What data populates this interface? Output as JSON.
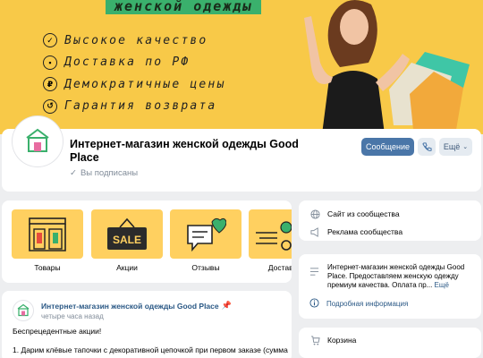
{
  "cover": {
    "title": "женской одежды",
    "features": [
      {
        "text": "Высокое качество",
        "icon": "quality-badge-icon"
      },
      {
        "text": "Доставка по РФ",
        "icon": "delivery-truck-icon"
      },
      {
        "text": "Демократичные цены",
        "icon": "ruble-icon"
      },
      {
        "text": "Гарантия возврата",
        "icon": "return-arrow-icon"
      }
    ]
  },
  "profile": {
    "name": "Интернет-магазин женской одежды Good Place",
    "status": "Вы подписаны",
    "message_label": "Сообщение",
    "more_label": "Ещё"
  },
  "categories": [
    {
      "label": "Товары",
      "icon": "storefront-icon"
    },
    {
      "label": "Акции",
      "icon": "sale-sign-icon"
    },
    {
      "label": "Отзывы",
      "icon": "heart-chat-icon"
    },
    {
      "label": "Доставка",
      "icon": "delivery-icon"
    }
  ],
  "post": {
    "author": "Интернет-магазин женской одежды Good Place",
    "time": "четыре часа назад",
    "text1": "Беспрецедентные акции!",
    "text2": "1. Дарим клёвые тапочки с декоративной цепочкой при первом заказе (сумма"
  },
  "side": {
    "site_link": "Сайт из сообщества",
    "ads_link": "Реклама сообщества",
    "about": "Интернет-магазин женской одежды Good Place. Предоставляем женскую одежду премиум качества. Оплата пр...",
    "about_more": "Ещё",
    "detail_link": "Подробная информация",
    "cart": "Корзина"
  },
  "colors": {
    "accent": "#4a76a8",
    "cover_bg": "#f8c948",
    "tile_bg": "#ffd060",
    "link": "#2a5885"
  }
}
